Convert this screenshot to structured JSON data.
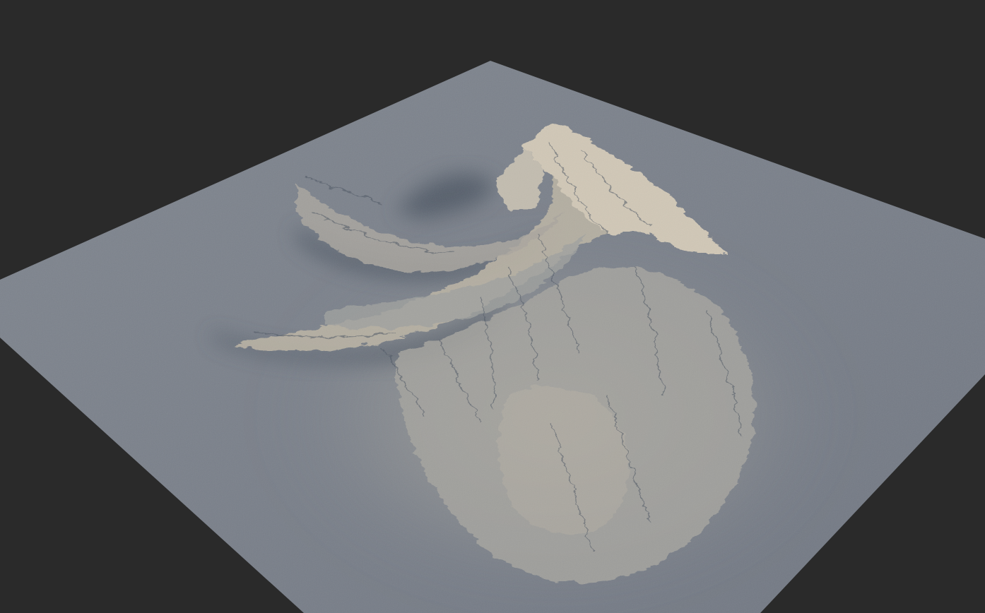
{
  "viewport": {
    "background_color": "#2a2a2a",
    "terrain_base_color": "#7a808a",
    "terrain_highlight_color": "#cdc3b1",
    "terrain_shadow_color": "#4a5260"
  },
  "scene": {
    "object": "terrain-heightfield",
    "features": [
      "spiral-ridge",
      "mountain-peak",
      "eroded-slopes",
      "flat-ground-plane"
    ]
  }
}
